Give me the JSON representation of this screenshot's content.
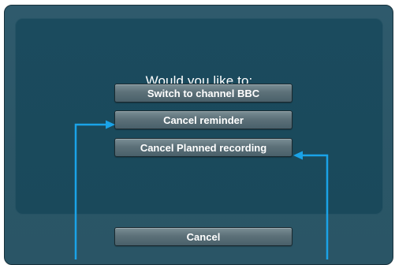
{
  "dialog": {
    "prompt": "Would you like to:",
    "options": [
      {
        "label": "Switch to channel BBC"
      },
      {
        "label": "Cancel reminder"
      },
      {
        "label": "Cancel Planned recording"
      }
    ]
  },
  "footer": {
    "cancel_label": "Cancel"
  },
  "colors": {
    "background": "#2f5a6c",
    "panel": "#1b4b5e",
    "button": "#5d7179",
    "annotation_arrow": "#1aa3e8"
  }
}
